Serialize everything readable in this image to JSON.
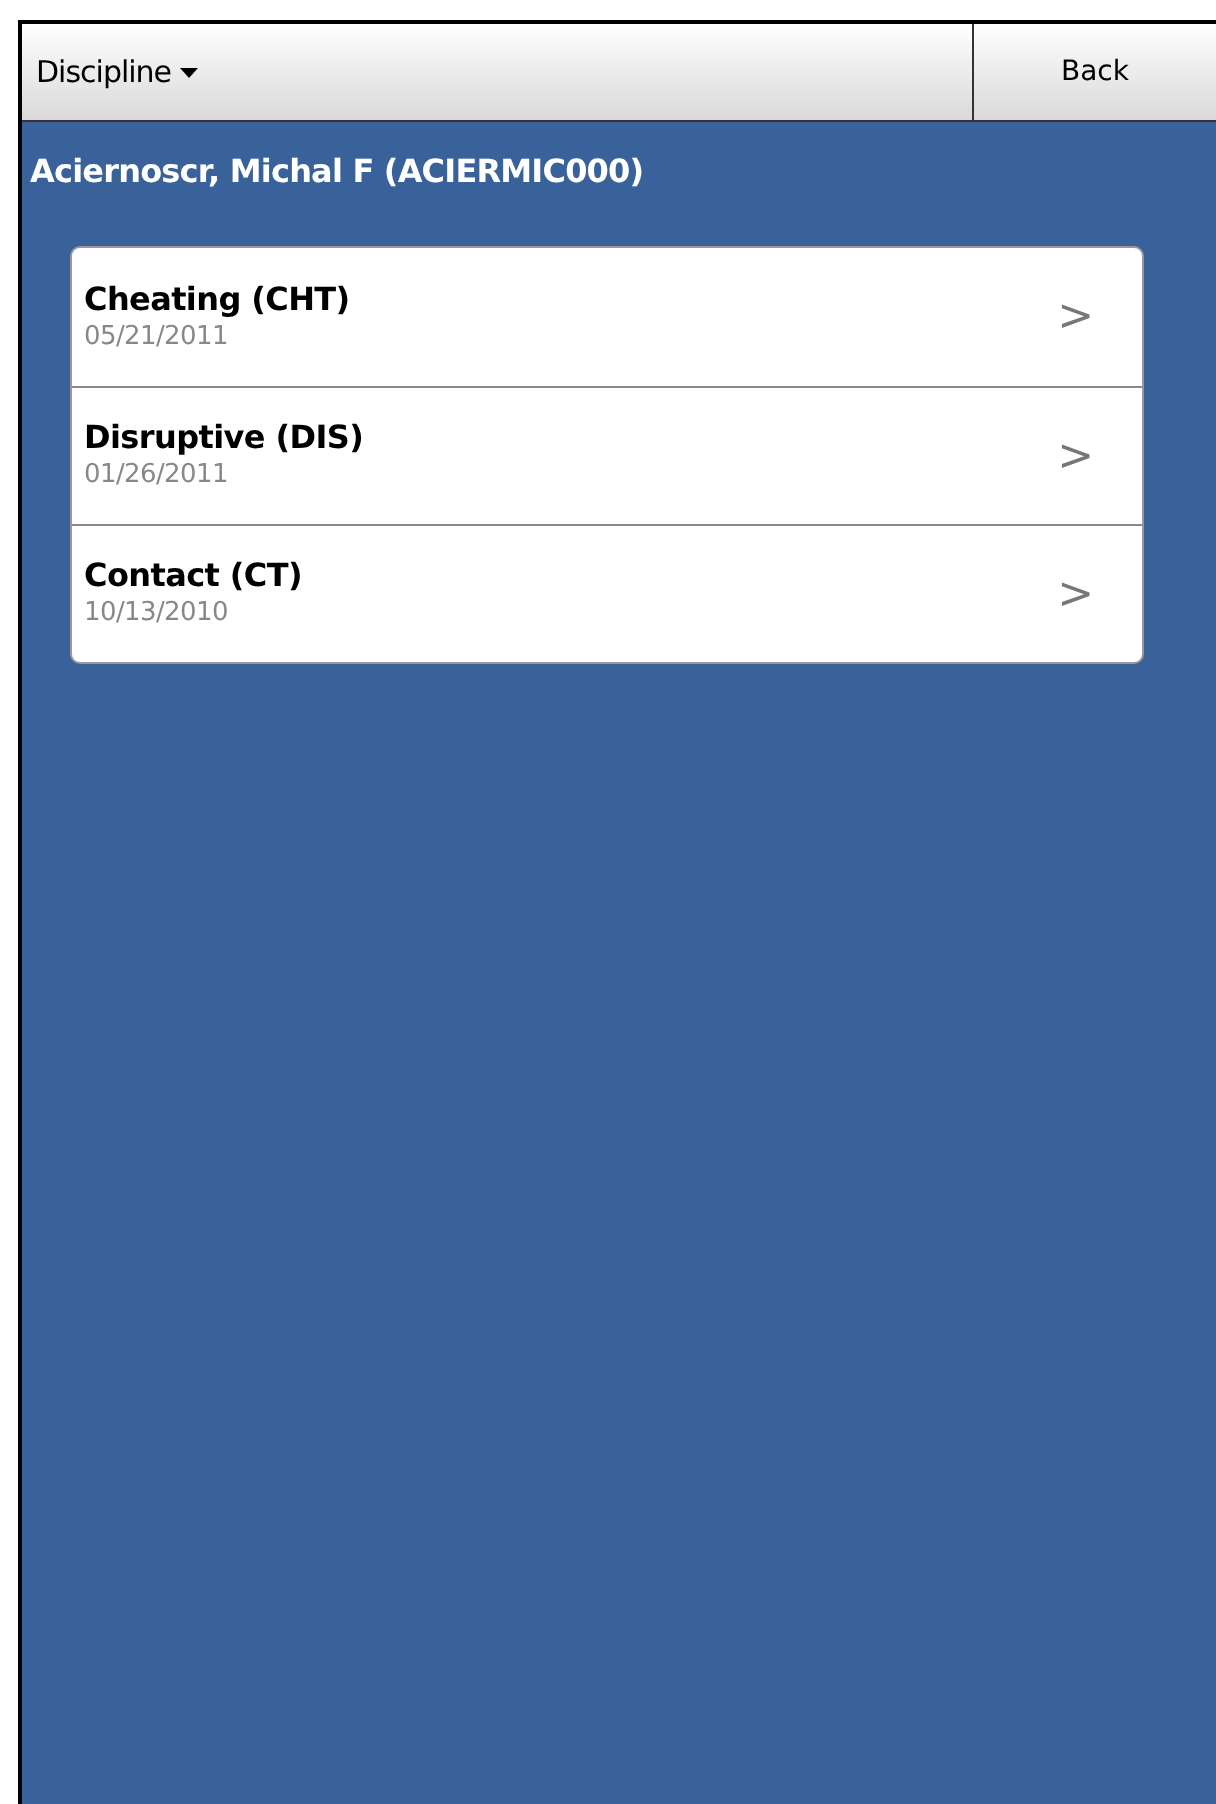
{
  "toolbar": {
    "menu_label": "Discipline",
    "back_label": "Back"
  },
  "student_name": "Aciernoscr, Michal F (ACIERMIC000)",
  "incidents": [
    {
      "title": "Cheating (CHT)",
      "date": "05/21/2011",
      "chevron": ">"
    },
    {
      "title": "Disruptive (DIS)",
      "date": "01/26/2011",
      "chevron": ">"
    },
    {
      "title": "Contact (CT)",
      "date": "10/13/2010",
      "chevron": ">"
    }
  ]
}
